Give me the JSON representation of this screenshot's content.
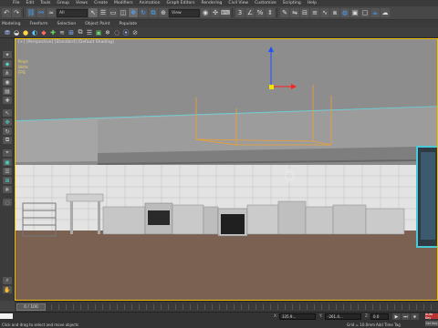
{
  "menu": {
    "items": [
      "File",
      "Edit",
      "Tools",
      "Group",
      "Views",
      "Create",
      "Modifiers",
      "Animation",
      "Graph Editors",
      "Rendering",
      "Civil View",
      "Customize",
      "Scripting",
      "Help"
    ]
  },
  "toolbar": {
    "selection_filter": "All",
    "view_dropdown": "View"
  },
  "ribbon": {
    "tabs": [
      "Modeling",
      "Freeform",
      "Selection",
      "Object Paint",
      "Populate"
    ]
  },
  "viewport": {
    "label": "[+] [Perspective] [Standard] [Default Shading]",
    "stats": [
      "Polys:",
      "Verts:",
      "FPS:"
    ]
  },
  "timeline": {
    "frame_label": "0 / 100"
  },
  "status": {
    "message": "Click and drag to select and move objects",
    "x_label": "X:",
    "x_value": "335.9...",
    "y_label": "Y:",
    "y_value": "-261.4...",
    "z_label": "Z:",
    "z_value": "0.0",
    "grid": "Grid = 10.0mm",
    "add_time_tag": "Add Time Tag",
    "auto_key": "Auto Key",
    "set_key": "Set Key"
  },
  "colors": {
    "selection_gizmo": "#f0a030",
    "viewport_bg": "#8a8a8a",
    "floor": "#7a6152",
    "wall_top": "#b9b9b9"
  }
}
